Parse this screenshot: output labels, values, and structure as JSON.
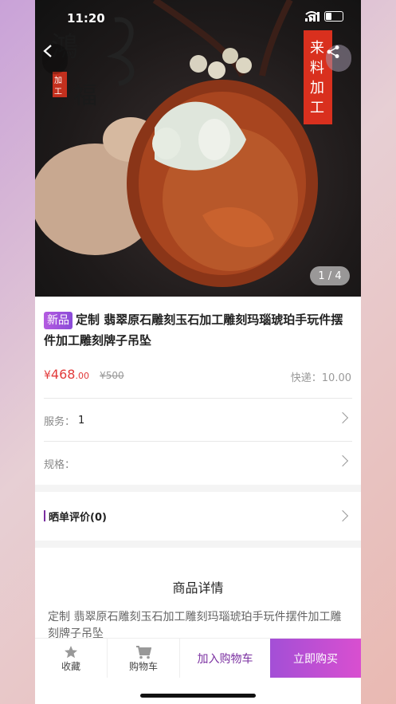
{
  "status": {
    "time": "11:20"
  },
  "hero": {
    "art_chars": {
      "c1": "鴻",
      "c2": "福",
      "c3": "加",
      "c4": "工"
    },
    "banner_text": "来料加工",
    "pager": "1 / 4"
  },
  "product": {
    "badge": "新品",
    "title": "定制 翡翠原石雕刻玉石加工雕刻玛瑙琥珀手玩件摆件加工雕刻牌子吊坠",
    "price_symbol": "¥",
    "price_int": "468",
    "price_dec": ".00",
    "old_price": "¥500",
    "shipping": "快递：10.00"
  },
  "service": {
    "label": "服务：",
    "value": "1"
  },
  "spec": {
    "label": "规格："
  },
  "review": {
    "title": "晒单评价(0)"
  },
  "detail": {
    "heading": "商品详情",
    "text": "定制 翡翠原石雕刻玉石加工雕刻玛瑙琥珀手玩件摆件加工雕刻牌子吊坠"
  },
  "bottom": {
    "favorite": "收藏",
    "cart": "购物车",
    "add_cart": "加入购物车",
    "buy_now": "立即购买"
  }
}
